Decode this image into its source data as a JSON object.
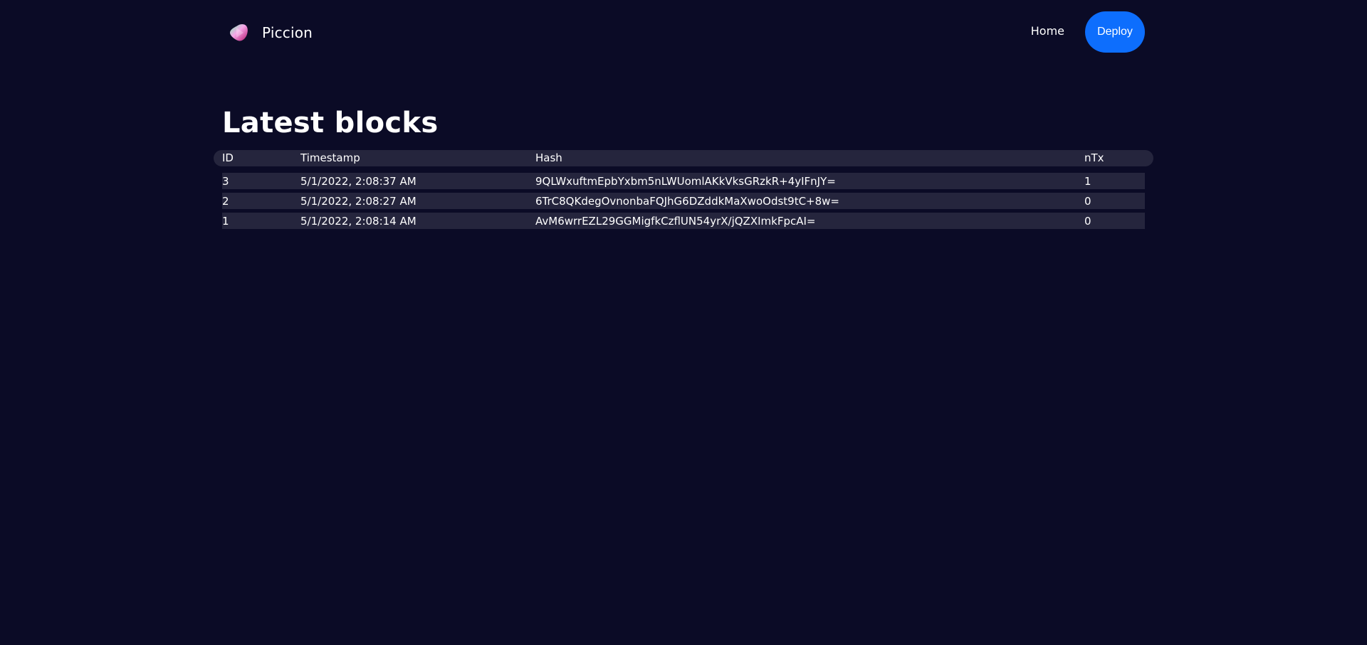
{
  "nav": {
    "brand": "Piccion",
    "home_label": "Home",
    "deploy_label": "Deploy"
  },
  "colors": {
    "background": "#0b0b26",
    "accent": "#0d6efd",
    "row_background": "#25253d"
  },
  "page": {
    "title": "Latest blocks"
  },
  "table": {
    "headers": [
      "ID",
      "Timestamp",
      "Hash",
      "nTx"
    ],
    "rows": [
      {
        "id": "3",
        "timestamp": "5/1/2022, 2:08:37 AM",
        "hash": "9QLWxuftmEpbYxbm5nLWUomlAKkVksGRzkR+4yIFnJY=",
        "ntx": "1"
      },
      {
        "id": "2",
        "timestamp": "5/1/2022, 2:08:27 AM",
        "hash": "6TrC8QKdegOvnonbaFQJhG6DZddkMaXwoOdst9tC+8w=",
        "ntx": "0"
      },
      {
        "id": "1",
        "timestamp": "5/1/2022, 2:08:14 AM",
        "hash": "AvM6wrrEZL29GGMigfkCzflUN54yrX/jQZXImkFpcAI=",
        "ntx": "0"
      }
    ]
  }
}
